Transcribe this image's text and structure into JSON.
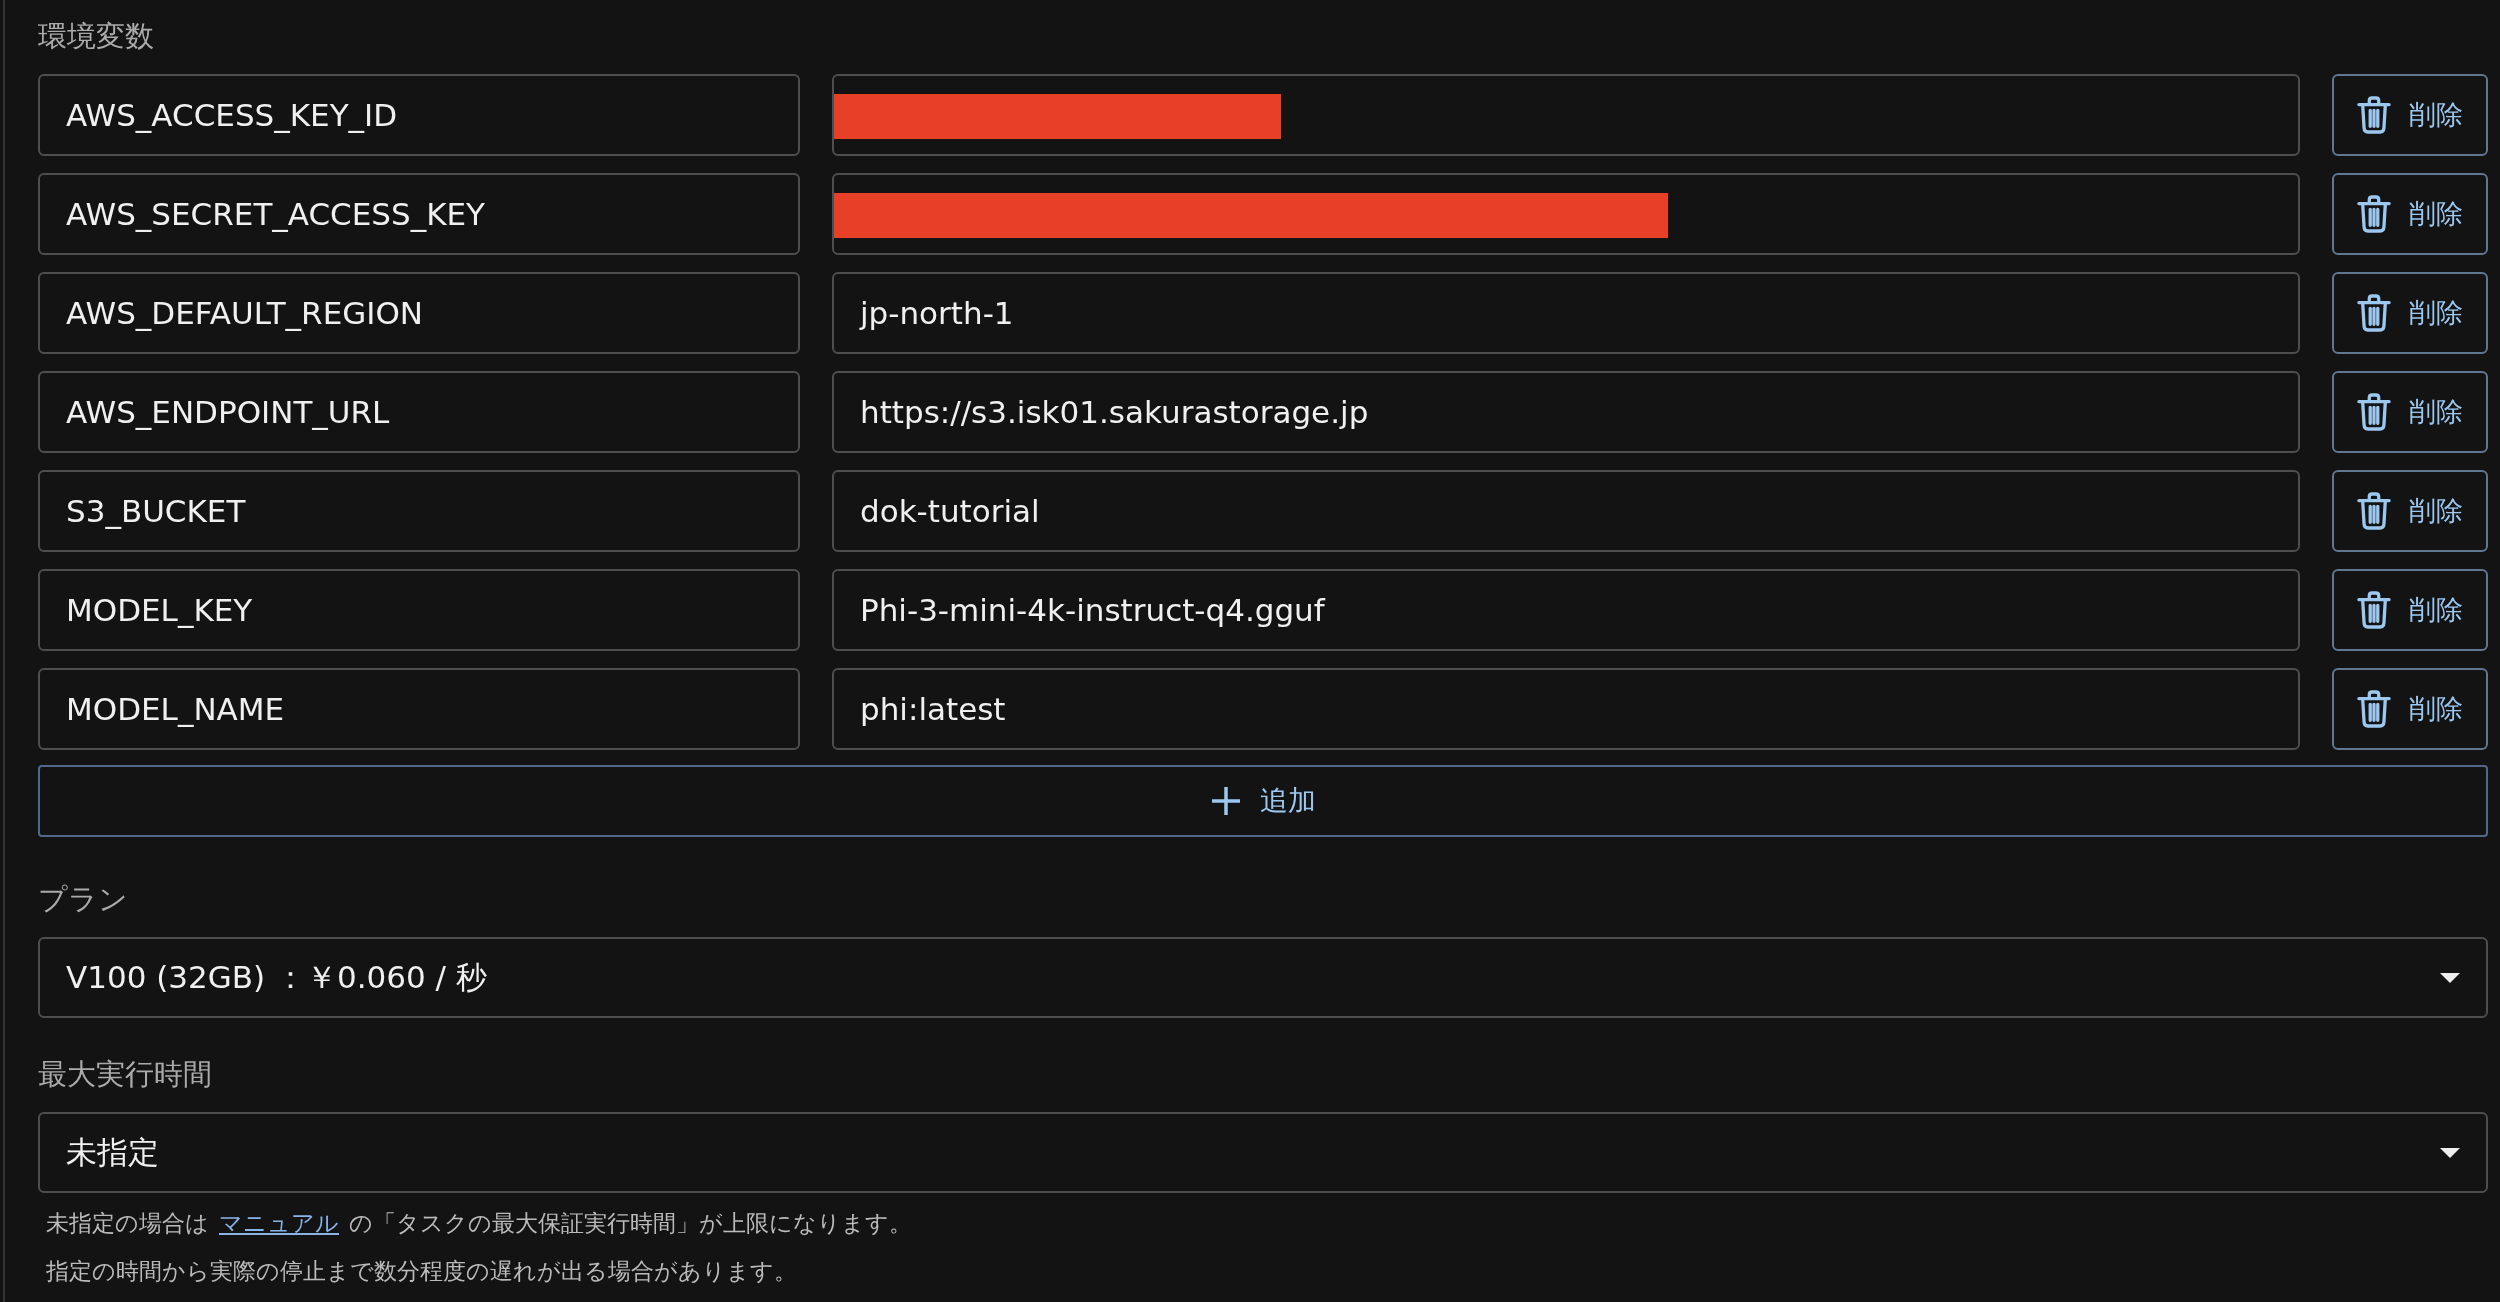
{
  "env_section": {
    "heading": "環境変数",
    "variables": [
      {
        "name": "AWS_ACCESS_KEY_ID",
        "redacted": true,
        "level": 0.305,
        "delete_label": "削除"
      },
      {
        "name": "AWS_SECRET_ACCESS_KEY",
        "redacted": true,
        "level": 0.57,
        "delete_label": "削除"
      },
      {
        "name": "AWS_DEFAULT_REGION",
        "value": "jp-north-1",
        "redacted": false,
        "delete_label": "削除"
      },
      {
        "name": "AWS_ENDPOINT_URL",
        "value": "https://s3.isk01.sakurastorage.jp",
        "redacted": false,
        "delete_label": "削除"
      },
      {
        "name": "S3_BUCKET",
        "value": "dok-tutorial",
        "redacted": false,
        "delete_label": "削除"
      },
      {
        "name": "MODEL_KEY",
        "value": "Phi-3-mini-4k-instruct-q4.gguf",
        "redacted": false,
        "delete_label": "削除"
      },
      {
        "name": "MODEL_NAME",
        "value": "phi:latest",
        "redacted": false,
        "delete_label": "削除"
      }
    ],
    "add_button": "追加"
  },
  "plan": {
    "label": "プラン",
    "value": "V100 (32GB) ：￥0.060 / 秒"
  },
  "max_runtime": {
    "label": "最大実行時間",
    "value": "未指定",
    "help": [
      {
        "before": "未指定の場合は",
        "link": "マニュアル",
        "after": "の「タスクの最大保証実行時間」が上限になります。"
      },
      {
        "before": "指定の時間から実際の停止まで数分程度の遅れが出る場合があります。"
      }
    ]
  }
}
